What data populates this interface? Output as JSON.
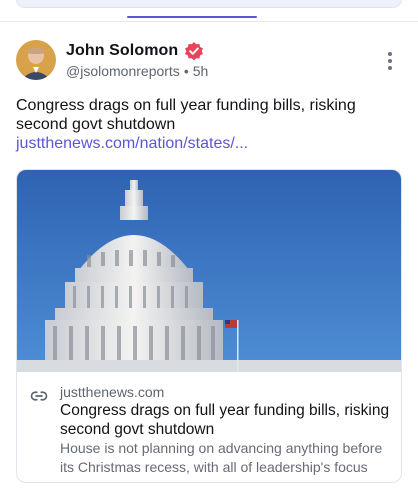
{
  "post": {
    "author_name": "John Solomon",
    "handle": "@jsolomonreports",
    "separator": "•",
    "time": "5h",
    "text": "Congress drags on full year funding bills, risking second govt shutdown ",
    "link_text": "justthenews.com/nation/states/..."
  },
  "card": {
    "domain": "justthenews.com",
    "title": "Congress drags on full year funding bills, risking second govt shutdown",
    "description": "House is not planning on advancing anything before its Christmas recess, with all of leadership's focus"
  },
  "colors": {
    "accent": "#5b55d6",
    "verified_badge": "#e8435c",
    "sky": "#2f6fc2"
  },
  "icons": {
    "verified": "verified-badge-icon",
    "more": "more-vertical-icon",
    "link": "link-icon"
  }
}
